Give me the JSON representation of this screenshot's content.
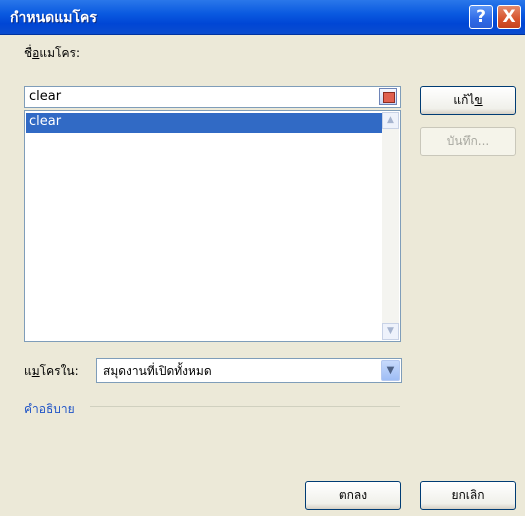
{
  "window": {
    "title": "กำหนดแมโคร"
  },
  "title_buttons": {
    "help": "?",
    "close": "X"
  },
  "macro_name": {
    "label_pre": "ชื่",
    "label_accel": "อ",
    "label_post": "แมโคร:",
    "value": "clear"
  },
  "macro_list": {
    "items": [
      "clear"
    ],
    "selected_index": 0
  },
  "buttons": {
    "edit_pre": "แก้ไ",
    "edit_accel": "ข",
    "save_label": "บันทึก...",
    "ok_label": "ตกลง",
    "cancel_label": "ยกเลิก"
  },
  "macros_in": {
    "label_pre": "แ",
    "label_accel": "ม",
    "label_post": "โครใน:",
    "selected": "สมุดงานที่เปิดทั้งหมด"
  },
  "description": {
    "label": "คำอธิบาย"
  }
}
